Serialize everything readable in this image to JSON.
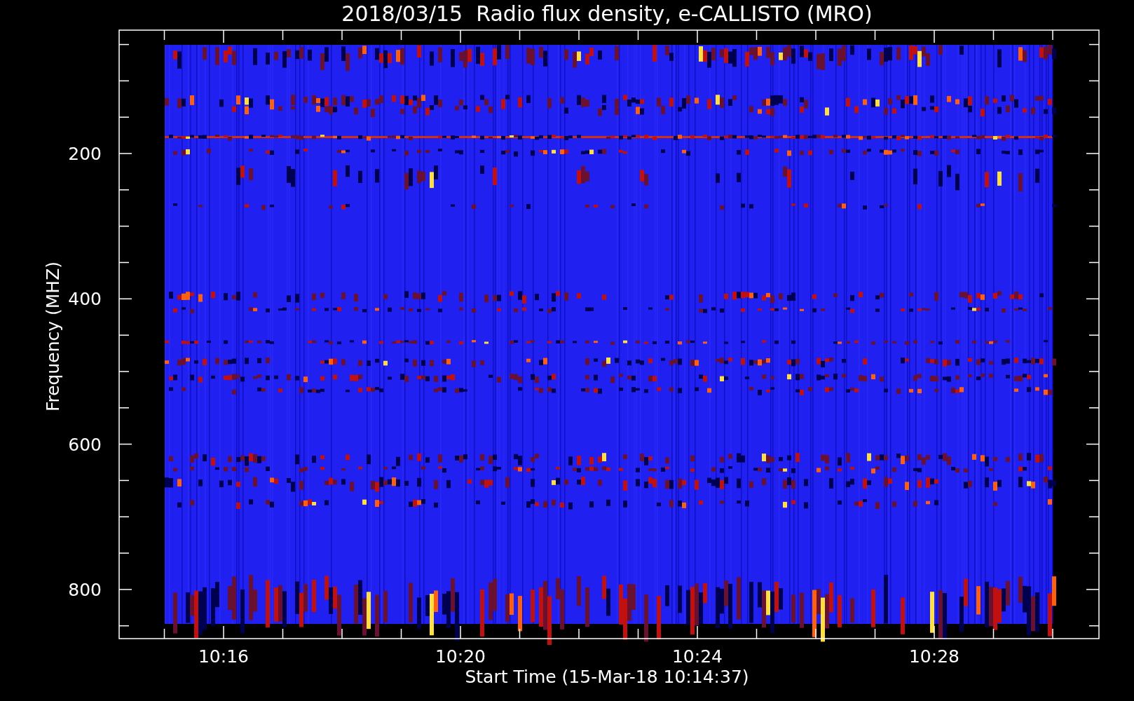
{
  "title": "2018/03/15  Radio flux density, e-CALLISTO (MRO)",
  "spectrogram": {
    "ylabel": "Frequency (MHZ)",
    "xlabel": "Start Time (15-Mar-18 10:14:37)",
    "yticks": [
      "200",
      "400",
      "600",
      "800"
    ],
    "xticks": [
      "10:16",
      "10:20",
      "10:24",
      "10:28"
    ]
  }
}
